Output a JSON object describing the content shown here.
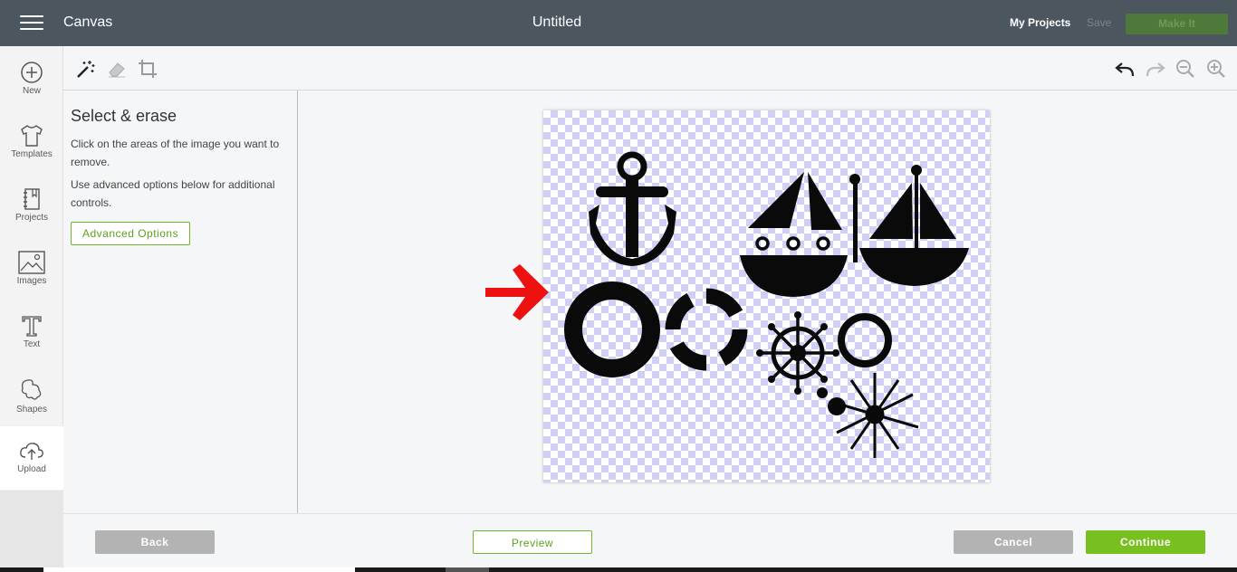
{
  "header": {
    "app_title": "Canvas",
    "doc_title": "Untitled",
    "my_projects": "My Projects",
    "save": "Save",
    "make_it": "Make It"
  },
  "sidebar": {
    "items": [
      {
        "label": "New",
        "icon": "plus-circle-icon"
      },
      {
        "label": "Templates",
        "icon": "tshirt-icon"
      },
      {
        "label": "Projects",
        "icon": "notebook-icon"
      },
      {
        "label": "Images",
        "icon": "image-icon"
      },
      {
        "label": "Text",
        "icon": "text-icon"
      },
      {
        "label": "Shapes",
        "icon": "shapes-icon"
      },
      {
        "label": "Upload",
        "icon": "upload-cloud-icon"
      }
    ]
  },
  "toolbar": {
    "left_icons": [
      "magic-wand-icon",
      "eraser-icon",
      "crop-icon"
    ],
    "right_icons": [
      "undo-icon",
      "redo-icon",
      "zoom-out-icon",
      "zoom-in-icon"
    ]
  },
  "panel": {
    "title": "Select & erase",
    "text1": "Click on the areas of the image you want to remove.",
    "text2": "Use advanced options below for additional controls.",
    "advanced": "Advanced Options"
  },
  "footer": {
    "back": "Back",
    "preview": "Preview",
    "cancel": "Cancel",
    "continue": "Continue"
  },
  "colors": {
    "topbar": "#4c565f",
    "accent_green": "#78c01f",
    "arrow_red": "#ee1111",
    "checker": "#d0d0f5"
  }
}
